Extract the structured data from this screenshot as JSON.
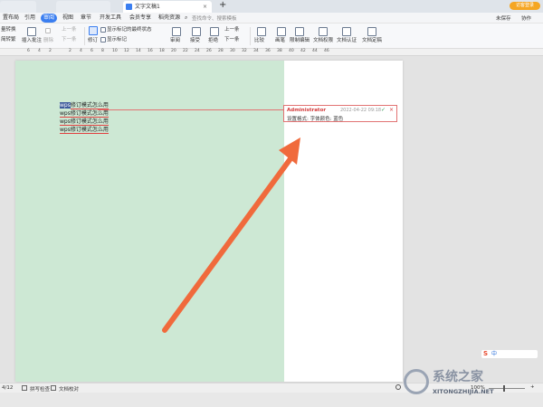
{
  "titlebar": {
    "tabs": [
      {
        "label": ""
      },
      {
        "label": ""
      },
      {
        "label": "文字文稿1"
      }
    ],
    "new_tab": "+",
    "right": {
      "cloud": "未保存",
      "collab": "协作",
      "share": "分享",
      "login": "访客登录"
    }
  },
  "menubar": {
    "items": [
      "置布局",
      "引用",
      "审阅",
      "视图",
      "章节",
      "开发工具",
      "会员专享",
      "稻壳资源"
    ],
    "active_index": 2,
    "search_placeholder": "查找命令、搜索模板"
  },
  "ribbon": {
    "left_group": [
      "量转换",
      "简转繁"
    ],
    "insert_comment": "插入批注",
    "delete": "删除",
    "prev": "上一条",
    "next": "下一条",
    "revise": "修订",
    "show_markup_state": "显示标记的最终状态",
    "show_markup": "显示标记",
    "review": "审阅",
    "accept": "接受",
    "reject": "拒绝",
    "prev2": "上一条",
    "next2": "下一条",
    "compare": "比较",
    "pen": "画笔",
    "limit_edit": "限制编辑",
    "doc_rights": "文档权限",
    "doc_auth": "文档认证",
    "doc_finalize": "文档定稿"
  },
  "ruler": [
    "6",
    "4",
    "2",
    "2",
    "4",
    "6",
    "8",
    "10",
    "12",
    "14",
    "16",
    "18",
    "20",
    "22",
    "24",
    "26",
    "28",
    "30",
    "32",
    "34",
    "36",
    "38",
    "40",
    "42",
    "44",
    "46"
  ],
  "document": {
    "lines": [
      {
        "prefix": "wps",
        "text": "修订模式怎么用"
      },
      {
        "prefix": "wps",
        "text": "修订模式怎么用"
      },
      {
        "prefix": "wps",
        "text": "修订模式怎么用"
      },
      {
        "prefix": "wps",
        "text": "修订模式怎么用"
      }
    ]
  },
  "comment": {
    "author": "Administrator",
    "date": "2022-04-22 09:18",
    "body": "设置格式: 字体颜色: 蓝色"
  },
  "statusbar": {
    "page": "4/12",
    "spell": "拼写检查",
    "proof": "文档校对",
    "zoom": "100%"
  },
  "watermark": {
    "cn": "系统之家",
    "en": "XITONGZHIJIA.NET"
  },
  "colors": {
    "accent": "#3a7ef0",
    "green_bg": "#cde8d4",
    "arrow": "#f06a3c",
    "comment_border": "#e27373"
  }
}
